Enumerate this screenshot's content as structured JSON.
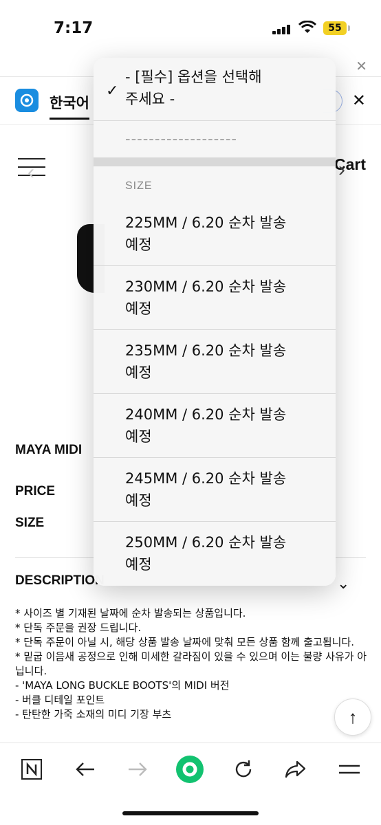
{
  "status": {
    "time": "7:17",
    "battery": "55"
  },
  "translate_bar": {
    "language": "한국어"
  },
  "page": {
    "cart": "Cart",
    "product_title": "MAYA MIDI",
    "price_label": "PRICE",
    "size_label": "SIZE",
    "description_label": "DESCRIPTION",
    "description_lines": [
      "* 사이즈 별 기재된 날짜에 순차 발송되는 상품입니다.",
      "* 단독 주문을 권장 드립니다.",
      "* 단독 주문이 아닐 시, 해당 상품 발송 날짜에 맞춰 모든 상품 함께 출고됩니다.",
      "* 밑굽 이음새 공정으로 인해 미세한 갈라짐이 있을 수 있으며 이는 불량 사유가 아닙니다.",
      "",
      "- 'MAYA LONG BUCKLE BOOTS'의 MIDI 버전",
      "- 버클 디테일 포인트",
      "- 탄탄한 가죽 소재의 미디 기장 부츠"
    ]
  },
  "dropdown": {
    "selected_line1": "- [필수] 옵션을 선택해",
    "selected_line2": "주세요 -",
    "separator": "-------------------",
    "group_header": "SIZE",
    "options": [
      {
        "line1": "225MM / 6.20 순차 발송",
        "line2": "예정"
      },
      {
        "line1": "230MM / 6.20 순차 발송",
        "line2": "예정"
      },
      {
        "line1": "235MM / 6.20 순차 발송",
        "line2": "예정"
      },
      {
        "line1": "240MM / 6.20 순차 발송",
        "line2": "예정"
      },
      {
        "line1": "245MM / 6.20 순차 발송",
        "line2": "예정"
      },
      {
        "line1": "250MM / 6.20 순차 발송",
        "line2": "예정"
      }
    ]
  },
  "colors": {
    "accent_green": "#12c270",
    "battery_yellow": "#f2d024",
    "logo_blue": "#1a8de0"
  },
  "icons": [
    "signal-icon",
    "wifi-icon",
    "close-icon",
    "menu-icon",
    "chevron-down-icon",
    "arrow-up-icon",
    "naver-n-icon",
    "back-icon",
    "forward-icon",
    "home-icon",
    "refresh-icon",
    "share-icon"
  ]
}
